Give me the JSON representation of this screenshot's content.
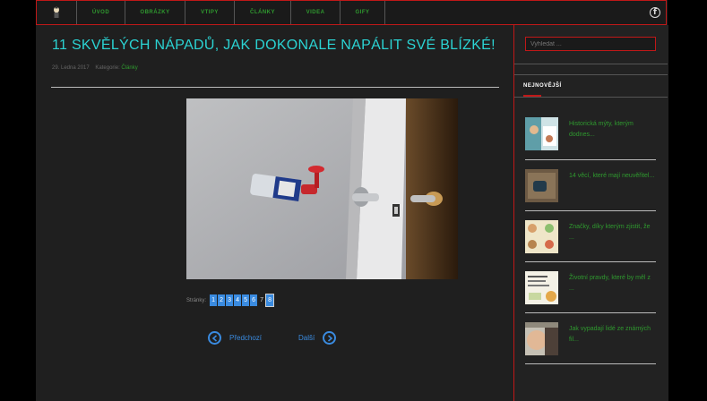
{
  "nav": {
    "items": [
      "ÚVOD",
      "OBRÁZKY",
      "VTIPY",
      "ČLÁNKY",
      "VIDEA",
      "GIFY"
    ]
  },
  "article": {
    "title": "11 SKVĚLÝCH NÁPADŮ, JAK DOKONALE NAPÁLIT SVÉ BLÍZKÉ!",
    "date": "29. Ledna 2017",
    "category_label": "Kategorie:",
    "category": "Články"
  },
  "pagination": {
    "label": "Stránky:",
    "pages": [
      "1",
      "2",
      "3",
      "4",
      "5",
      "6",
      "7",
      "8"
    ],
    "current": "7"
  },
  "prev_label": "Předchozí",
  "next_label": "Další",
  "sidebar": {
    "search_placeholder": "Vyhledat ...",
    "heading": "NEJNOVĚJŠÍ",
    "items": [
      "Historická mýty, kterým dodnes...",
      "14 věcí, které mají neuvěřitel...",
      "Značky, díky kterým zjistit, že ...",
      "Životní pravdy, které by měl z ...",
      "Jak vypadají lidé ze známých fil..."
    ]
  },
  "colors": {
    "accent_red": "#c01818",
    "title_cyan": "#2bd3d3",
    "link_green": "#2f9a2f",
    "button_blue": "#3a8be0"
  }
}
